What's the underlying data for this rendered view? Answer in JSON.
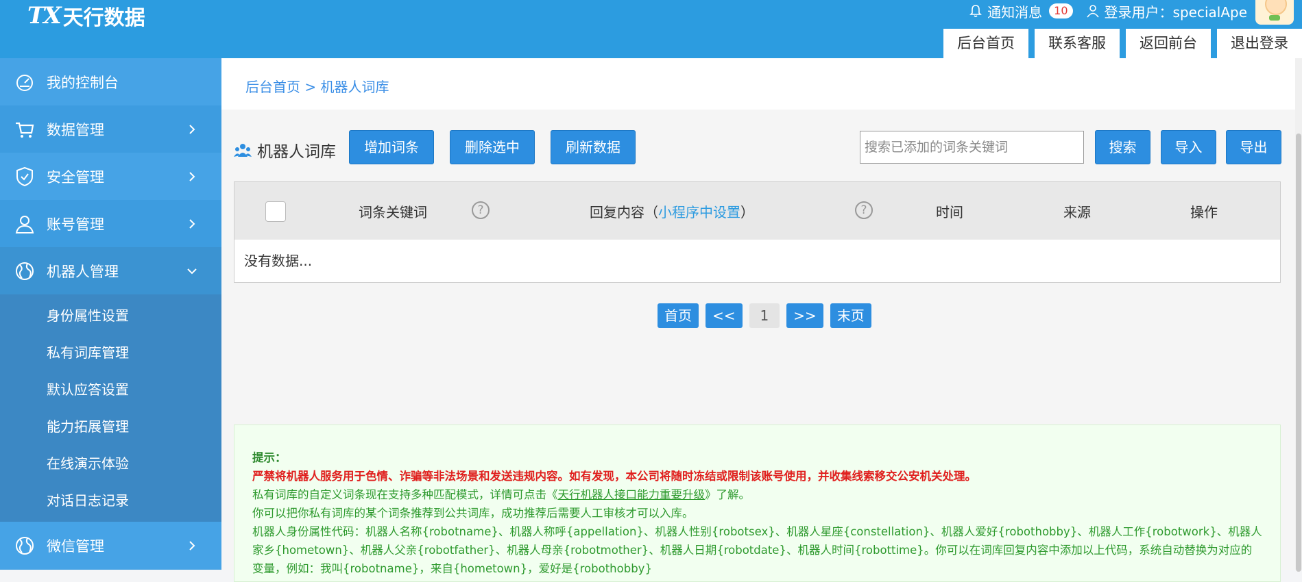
{
  "header": {
    "logo_mark": "TX",
    "logo_text": "天行数据",
    "notify_label": "通知消息",
    "notify_count": "10",
    "user_label": "登录用户：specialApe",
    "tabs": [
      "后台首页",
      "联系客服",
      "返回前台",
      "退出登录"
    ]
  },
  "sidebar": {
    "items": [
      {
        "label": "我的控制台",
        "icon": "dashboard-icon"
      },
      {
        "label": "数据管理",
        "icon": "cart-icon"
      },
      {
        "label": "安全管理",
        "icon": "shield-icon"
      },
      {
        "label": "账号管理",
        "icon": "user-icon"
      },
      {
        "label": "机器人管理",
        "icon": "globe-icon"
      },
      {
        "label": "微信管理",
        "icon": "globe-icon"
      }
    ],
    "submenu": [
      "身份属性设置",
      "私有词库管理",
      "默认应答设置",
      "能力拓展管理",
      "在线演示体验",
      "对话日志记录"
    ]
  },
  "breadcrumb": "后台首页 > 机器人词库",
  "toolbar": {
    "title": "机器人词库",
    "add": "增加词条",
    "delete": "删除选中",
    "refresh": "刷新数据",
    "search_placeholder": "搜索已添加的词条关键词",
    "search": "搜索",
    "import": "导入",
    "export": "导出"
  },
  "table": {
    "col_keyword": "词条关键词",
    "col_reply": "回复内容（",
    "col_reply_link": "小程序中设置",
    "col_reply_end": "）",
    "col_time": "时间",
    "col_source": "来源",
    "col_action": "操作",
    "help_mark": "?",
    "empty": "没有数据..."
  },
  "pager": {
    "first": "首页",
    "prev": "<<",
    "current": "1",
    "next": ">>",
    "last": "末页"
  },
  "notice": {
    "title": "提示：",
    "warn": "严禁将机器人服务用于色情、诈骗等非法场景和发送违规内容。如有发现，本公司将随时冻结或限制该账号使用，并收集线索移交公安机关处理。",
    "line1_pre": "私有词库的自定义词条现在支持多种匹配模式，详情可点击《",
    "line1_link": "天行机器人接口能力重要升级",
    "line1_post": "》了解。",
    "line2": "你可以把你私有词库的某个词条推荐到公共词库，成功推荐后需要人工审核才可以入库。",
    "line3": "机器人身份属性代码：机器人名称{robotname}、机器人称呼{appellation}、机器人性别{robotsex}、机器人星座{constellation}、机器人爱好{robothobby}、机器人工作{robotwork}、机器人家乡{hometown}、机器人父亲{robotfather}、机器人母亲{robotmother}、机器人日期{robotdate}、机器人时间{robottime}。你可以在词库回复内容中添加以上代码，系统自动替换为对应的变量，例如：我叫{robotname}，来自{hometown}，爱好是{robothobby}"
  },
  "colors": {
    "primary": "#2d8ee0",
    "header": "#2c9ce0",
    "sidebar": "#3d9ce0",
    "notice_text": "#2e9a2e",
    "warn_text": "#e0201e"
  }
}
